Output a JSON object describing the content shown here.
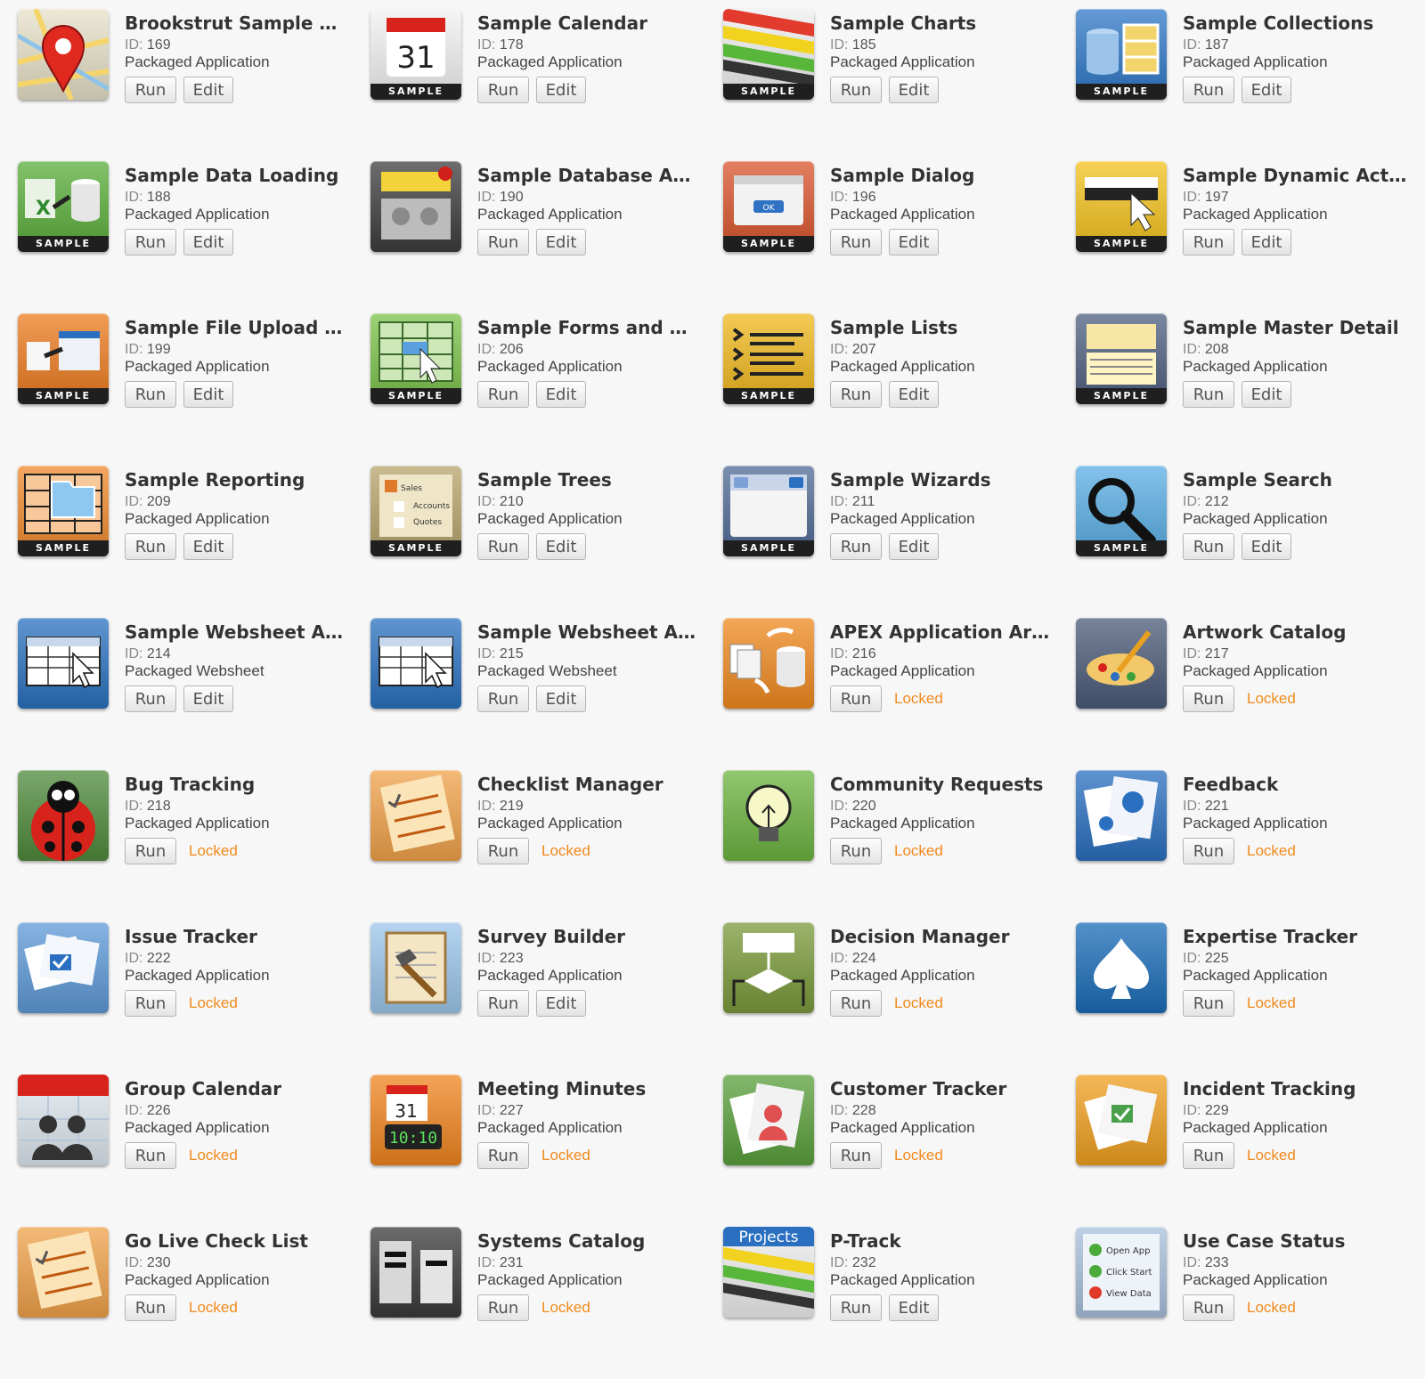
{
  "labels": {
    "id_prefix": "ID: ",
    "run": "Run",
    "edit": "Edit",
    "locked": "Locked",
    "sample_band": "SAMPLE"
  },
  "apps": [
    {
      "title": "Brookstrut Sample Ap…",
      "id": "169",
      "kind": "Packaged Application",
      "action": "edit",
      "icon": "map-pin-icon",
      "bg": "#e6e1c8",
      "band": false
    },
    {
      "title": "Sample Calendar",
      "id": "178",
      "kind": "Packaged Application",
      "action": "edit",
      "icon": "calendar-icon",
      "bg": "#f2f2f2",
      "band": true,
      "glyph_text": "31"
    },
    {
      "title": "Sample Charts",
      "id": "185",
      "kind": "Packaged Application",
      "action": "edit",
      "icon": "charts-icon",
      "bg": "#efefef",
      "band": true
    },
    {
      "title": "Sample Collections",
      "id": "187",
      "kind": "Packaged Application",
      "action": "edit",
      "icon": "collections-icon",
      "bg": "#2f78c8",
      "band": true
    },
    {
      "title": "Sample Data Loading",
      "id": "188",
      "kind": "Packaged Application",
      "action": "edit",
      "icon": "data-loading-icon",
      "bg": "#5aae3a",
      "band": true
    },
    {
      "title": "Sample Database App…",
      "id": "190",
      "kind": "Packaged Application",
      "action": "edit",
      "icon": "database-app-icon",
      "bg": "#3d3d3d",
      "band": false
    },
    {
      "title": "Sample Dialog",
      "id": "196",
      "kind": "Packaged Application",
      "action": "edit",
      "icon": "dialog-icon",
      "bg": "#d9542c",
      "band": true,
      "glyph_text": "OK"
    },
    {
      "title": "Sample Dynamic Acti…",
      "id": "197",
      "kind": "Packaged Application",
      "action": "edit",
      "icon": "dynamic-actions-icon",
      "bg": "#f3c21c",
      "band": true
    },
    {
      "title": "Sample File Upload an…",
      "id": "199",
      "kind": "Packaged Application",
      "action": "edit",
      "icon": "file-upload-icon",
      "bg": "#ec7b1f",
      "band": true
    },
    {
      "title": "Sample Forms and Gri…",
      "id": "206",
      "kind": "Packaged Application",
      "action": "edit",
      "icon": "forms-grid-icon",
      "bg": "#7cc24a",
      "band": true
    },
    {
      "title": "Sample Lists",
      "id": "207",
      "kind": "Packaged Application",
      "action": "edit",
      "icon": "lists-icon",
      "bg": "#f0b81c",
      "band": true
    },
    {
      "title": "Sample Master Detail",
      "id": "208",
      "kind": "Packaged Application",
      "action": "edit",
      "icon": "master-detail-icon",
      "bg": "#4e5f80",
      "band": true
    },
    {
      "title": "Sample Reporting",
      "id": "209",
      "kind": "Packaged Application",
      "action": "edit",
      "icon": "reporting-icon",
      "bg": "#f08a2c",
      "band": true
    },
    {
      "title": "Sample Trees",
      "id": "210",
      "kind": "Packaged Application",
      "action": "edit",
      "icon": "trees-icon",
      "bg": "#b7a46c",
      "band": true,
      "glyph_lines": [
        "Sales",
        "Accounts",
        "Quotes"
      ]
    },
    {
      "title": "Sample Wizards",
      "id": "211",
      "kind": "Packaged Application",
      "action": "edit",
      "icon": "wizards-icon",
      "bg": "#4f6a95",
      "band": true
    },
    {
      "title": "Sample Search",
      "id": "212",
      "kind": "Packaged Application",
      "action": "edit",
      "icon": "search-icon",
      "bg": "#5aaee5",
      "band": true
    },
    {
      "title": "Sample Websheet Ap…",
      "id": "214",
      "kind": "Packaged Websheet",
      "action": "edit",
      "icon": "websheet-icon",
      "bg": "#2a72c0",
      "band": false
    },
    {
      "title": "Sample Websheet Ap…",
      "id": "215",
      "kind": "Packaged Websheet",
      "action": "edit",
      "icon": "websheet-icon",
      "bg": "#2a72c0",
      "band": false
    },
    {
      "title": "APEX Application Arc…",
      "id": "216",
      "kind": "Packaged Application",
      "action": "locked",
      "icon": "archive-icon",
      "bg": "#f08a1f",
      "band": false
    },
    {
      "title": "Artwork Catalog",
      "id": "217",
      "kind": "Packaged Application",
      "action": "locked",
      "icon": "palette-icon",
      "bg": "#4a5a78",
      "band": false
    },
    {
      "title": "Bug Tracking",
      "id": "218",
      "kind": "Packaged Application",
      "action": "locked",
      "icon": "ladybug-icon",
      "bg": "#4f8a3a",
      "band": false
    },
    {
      "title": "Checklist Manager",
      "id": "219",
      "kind": "Packaged Application",
      "action": "locked",
      "icon": "checklist-icon",
      "bg": "#f0a24a",
      "band": false
    },
    {
      "title": "Community Requests",
      "id": "220",
      "kind": "Packaged Application",
      "action": "locked",
      "icon": "lightbulb-icon",
      "bg": "#6cb440",
      "band": false
    },
    {
      "title": "Feedback",
      "id": "221",
      "kind": "Packaged Application",
      "action": "locked",
      "icon": "feedback-icon",
      "bg": "#2a6fc0",
      "band": false
    },
    {
      "title": "Issue Tracker",
      "id": "222",
      "kind": "Packaged Application",
      "action": "locked",
      "icon": "issue-tracker-icon",
      "bg": "#5e9ad8",
      "band": false
    },
    {
      "title": "Survey Builder",
      "id": "223",
      "kind": "Packaged Application",
      "action": "edit",
      "icon": "survey-icon",
      "bg": "#9cc6ea",
      "band": false
    },
    {
      "title": "Decision Manager",
      "id": "224",
      "kind": "Packaged Application",
      "action": "locked",
      "icon": "decision-icon",
      "bg": "#7a9a3a",
      "band": false
    },
    {
      "title": "Expertise Tracker",
      "id": "225",
      "kind": "Packaged Application",
      "action": "locked",
      "icon": "spade-icon",
      "bg": "#1a6cb8",
      "band": false
    },
    {
      "title": "Group Calendar",
      "id": "226",
      "kind": "Packaged Application",
      "action": "locked",
      "icon": "group-calendar-icon",
      "bg": "#dfe8f0",
      "band": false
    },
    {
      "title": "Meeting Minutes",
      "id": "227",
      "kind": "Packaged Application",
      "action": "locked",
      "icon": "meeting-minutes-icon",
      "bg": "#f0851f",
      "band": false,
      "glyph_text": "31",
      "glyph_clock": "10:10"
    },
    {
      "title": "Customer Tracker",
      "id": "228",
      "kind": "Packaged Application",
      "action": "locked",
      "icon": "customer-icon",
      "bg": "#5aa03c",
      "band": false
    },
    {
      "title": "Incident Tracking",
      "id": "229",
      "kind": "Packaged Application",
      "action": "locked",
      "icon": "incident-icon",
      "bg": "#f0a020",
      "band": false
    },
    {
      "title": "Go Live Check List",
      "id": "230",
      "kind": "Packaged Application",
      "action": "locked",
      "icon": "checklist-icon",
      "bg": "#f0a24a",
      "band": false
    },
    {
      "title": "Systems Catalog",
      "id": "231",
      "kind": "Packaged Application",
      "action": "locked",
      "icon": "server-icon",
      "bg": "#3a3a3a",
      "band": false
    },
    {
      "title": "P-Track",
      "id": "232",
      "kind": "Packaged Application",
      "action": "edit",
      "icon": "projects-icon",
      "bg": "#efefef",
      "band": false,
      "glyph_text": "Projects"
    },
    {
      "title": "Use Case Status",
      "id": "233",
      "kind": "Packaged Application",
      "action": "locked",
      "icon": "use-case-icon",
      "bg": "#a8c0dc",
      "band": false,
      "glyph_lines": [
        "Open App",
        "Click Start",
        "View Data"
      ]
    }
  ]
}
